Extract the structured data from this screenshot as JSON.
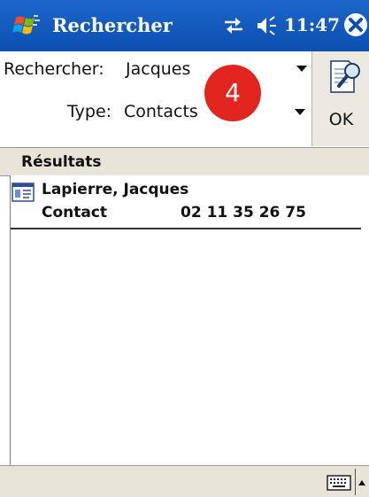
{
  "titlebar": {
    "title": "Rechercher",
    "time": "11:47",
    "color": "#1458bd",
    "icons": [
      "windows-start-icon",
      "connectivity-icon",
      "speaker-icon",
      "close-icon"
    ]
  },
  "search": {
    "rechercher_label": "Rechercher:",
    "rechercher_value": "Jacques",
    "type_label": "Type:",
    "type_value": "Contacts",
    "step_badge": "4",
    "badge_color": "#e0261e",
    "ok_label": "OK"
  },
  "results": {
    "header": "Résultats",
    "items": [
      {
        "name": "Lapierre, Jacques",
        "type": "Contact",
        "phone": "02 11 35 26 75"
      }
    ]
  }
}
